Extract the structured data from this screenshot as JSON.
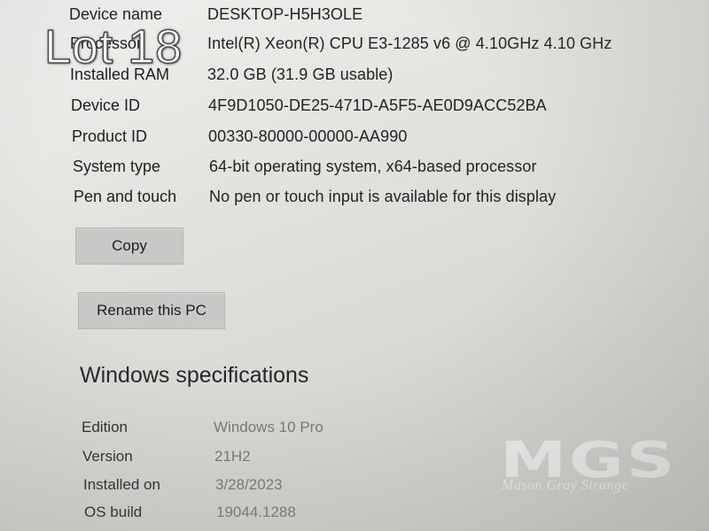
{
  "overlay": {
    "lot_label": "Lot 18"
  },
  "device_specs": {
    "rows": [
      {
        "label": "Device name",
        "value": "DESKTOP-H5H3OLE"
      },
      {
        "label": "Processor",
        "value": "Intel(R) Xeon(R) CPU E3-1285 v6 @ 4.10GHz   4.10 GHz"
      },
      {
        "label": "Installed RAM",
        "value": "32.0 GB (31.9 GB usable)"
      },
      {
        "label": "Device ID",
        "value": "4F9D1050-DE25-471D-A5F5-AE0D9ACC52BA"
      },
      {
        "label": "Product ID",
        "value": "00330-80000-00000-AA990"
      },
      {
        "label": "System type",
        "value": "64-bit operating system, x64-based processor"
      },
      {
        "label": "Pen and touch",
        "value": "No pen or touch input is available for this display"
      }
    ],
    "copy_label": "Copy",
    "rename_label": "Rename this PC"
  },
  "windows_specs": {
    "title": "Windows specifications",
    "rows": [
      {
        "label": "Edition",
        "value": "Windows 10 Pro"
      },
      {
        "label": "Version",
        "value": "21H2"
      },
      {
        "label": "Installed on",
        "value": "3/28/2023"
      },
      {
        "label": "OS build",
        "value": "19044.1288"
      }
    ]
  },
  "watermark": {
    "logo": "MGS",
    "text": "Mason Gray Strange"
  }
}
